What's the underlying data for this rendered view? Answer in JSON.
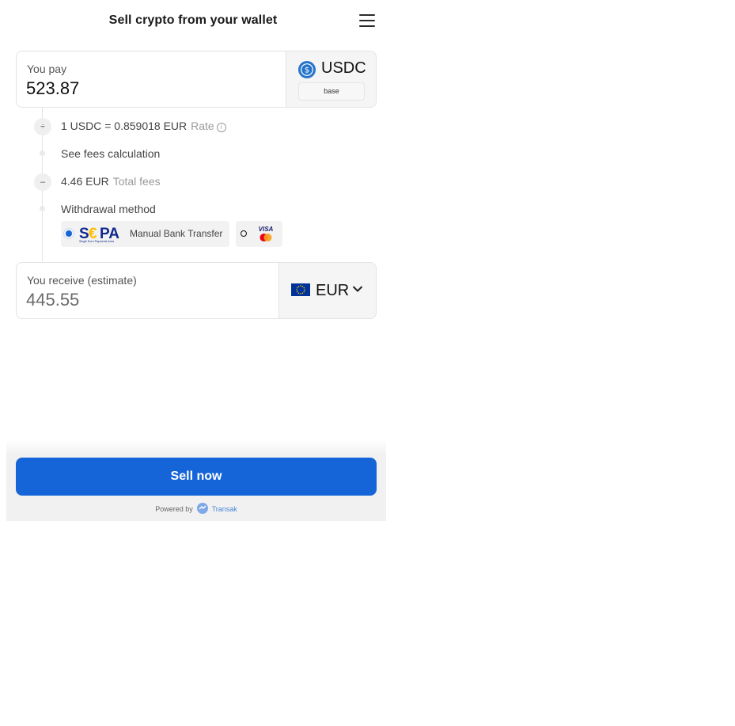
{
  "header": {
    "title": "Sell crypto from your wallet"
  },
  "pay": {
    "label": "You pay",
    "amount": "523.87",
    "currency": "USDC",
    "network": "base"
  },
  "rate": {
    "text": "1 USDC = 0.859018 EUR",
    "label": "Rate",
    "info_icon": "i"
  },
  "fees": {
    "link_text": "See fees calculation",
    "amount": "4.46 EUR",
    "label": "Total fees"
  },
  "withdrawal": {
    "title": "Withdrawal method",
    "options": [
      {
        "id": "sepa",
        "label": "Manual Bank Transfer",
        "selected": true,
        "logo_text": "SEPA",
        "logo_subtext": "Single Euro Payments Area"
      },
      {
        "id": "card",
        "label": "",
        "selected": false,
        "logo_text": "VISA"
      }
    ]
  },
  "receive": {
    "label": "You receive (estimate)",
    "amount": "445.55",
    "currency": "EUR"
  },
  "steps": {
    "divide_symbol": "÷",
    "minus_symbol": "–"
  },
  "footer": {
    "button_label": "Sell now",
    "powered_by": "Powered by",
    "brand": "Transak"
  },
  "colors": {
    "accent": "#1565d8",
    "usdc_blue": "#2775ca",
    "eu_blue": "#003399",
    "eu_star": "#ffcc00"
  }
}
